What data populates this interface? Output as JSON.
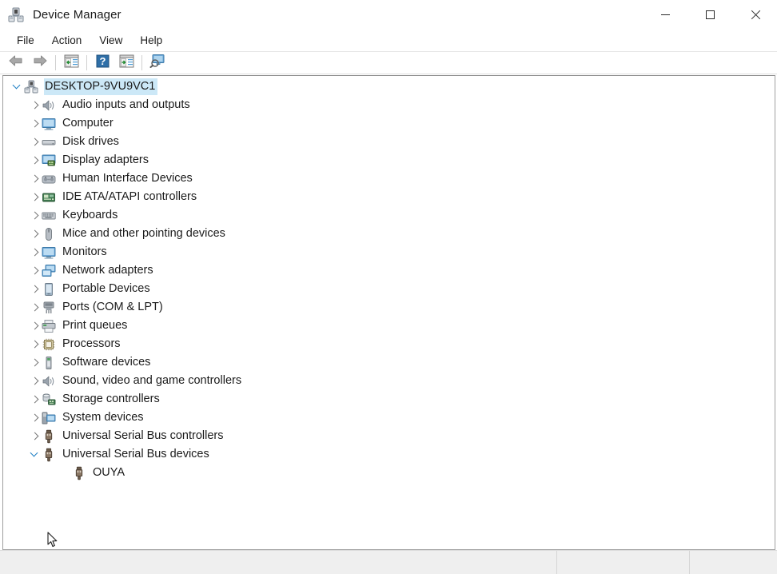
{
  "window": {
    "title": "Device Manager",
    "icon": "device-manager-icon",
    "controls": {
      "minimize": "Minimize",
      "maximize": "Maximize",
      "close": "Close"
    }
  },
  "menubar": {
    "items": [
      {
        "label": "File"
      },
      {
        "label": "Action"
      },
      {
        "label": "View"
      },
      {
        "label": "Help"
      }
    ]
  },
  "toolbar": {
    "buttons": [
      {
        "name": "back-button",
        "icon": "back-arrow-icon",
        "tooltip": "Back"
      },
      {
        "name": "forward-button",
        "icon": "forward-arrow-icon",
        "tooltip": "Forward"
      },
      {
        "name": "show-hide-console-tree-button",
        "icon": "console-tree-icon",
        "tooltip": "Show/Hide Console Tree"
      },
      {
        "name": "help-button",
        "icon": "help-question-icon",
        "tooltip": "Help"
      },
      {
        "name": "properties-button",
        "icon": "properties-icon",
        "tooltip": "Properties"
      },
      {
        "name": "scan-hardware-changes-button",
        "icon": "scan-hardware-icon",
        "tooltip": "Scan for hardware changes"
      }
    ]
  },
  "tree": {
    "root": {
      "label": "DESKTOP-9VU9VC1",
      "icon": "computer-root-icon",
      "expanded": true,
      "selected": true
    },
    "nodes": [
      {
        "label": "Audio inputs and outputs",
        "icon": "speaker-icon",
        "expanded": false,
        "depth": 1
      },
      {
        "label": "Computer",
        "icon": "monitor-icon",
        "expanded": false,
        "depth": 1
      },
      {
        "label": "Disk drives",
        "icon": "disk-drive-icon",
        "expanded": false,
        "depth": 1
      },
      {
        "label": "Display adapters",
        "icon": "display-adapter-icon",
        "expanded": false,
        "depth": 1
      },
      {
        "label": "Human Interface Devices",
        "icon": "hid-icon",
        "expanded": false,
        "depth": 1
      },
      {
        "label": "IDE ATA/ATAPI controllers",
        "icon": "ide-controller-icon",
        "expanded": false,
        "depth": 1
      },
      {
        "label": "Keyboards",
        "icon": "keyboard-icon",
        "expanded": false,
        "depth": 1
      },
      {
        "label": "Mice and other pointing devices",
        "icon": "mouse-icon",
        "expanded": false,
        "depth": 1
      },
      {
        "label": "Monitors",
        "icon": "monitor-icon",
        "expanded": false,
        "depth": 1
      },
      {
        "label": "Network adapters",
        "icon": "network-adapter-icon",
        "expanded": false,
        "depth": 1
      },
      {
        "label": "Portable Devices",
        "icon": "portable-device-icon",
        "expanded": false,
        "depth": 1
      },
      {
        "label": "Ports (COM & LPT)",
        "icon": "port-icon",
        "expanded": false,
        "depth": 1
      },
      {
        "label": "Print queues",
        "icon": "printer-icon",
        "expanded": false,
        "depth": 1
      },
      {
        "label": "Processors",
        "icon": "processor-icon",
        "expanded": false,
        "depth": 1
      },
      {
        "label": "Software devices",
        "icon": "software-device-icon",
        "expanded": false,
        "depth": 1
      },
      {
        "label": "Sound, video and game controllers",
        "icon": "speaker-icon",
        "expanded": false,
        "depth": 1
      },
      {
        "label": "Storage controllers",
        "icon": "storage-controller-icon",
        "expanded": false,
        "depth": 1
      },
      {
        "label": "System devices",
        "icon": "system-device-icon",
        "expanded": false,
        "depth": 1
      },
      {
        "label": "Universal Serial Bus controllers",
        "icon": "usb-icon",
        "expanded": false,
        "depth": 1
      },
      {
        "label": "Universal Serial Bus devices",
        "icon": "usb-icon",
        "expanded": true,
        "depth": 1
      },
      {
        "label": "OUYA",
        "icon": "usb-icon",
        "expanded": null,
        "depth": 2
      }
    ]
  },
  "statusbar": {
    "panes": [
      "",
      "",
      ""
    ]
  },
  "colors": {
    "selection": "#cce8f7",
    "window_bg": "#ffffff",
    "status_bg": "#efefef",
    "text": "#1b1b1b",
    "chevron": "#767676",
    "chevron_open": "#1f7fc4"
  }
}
